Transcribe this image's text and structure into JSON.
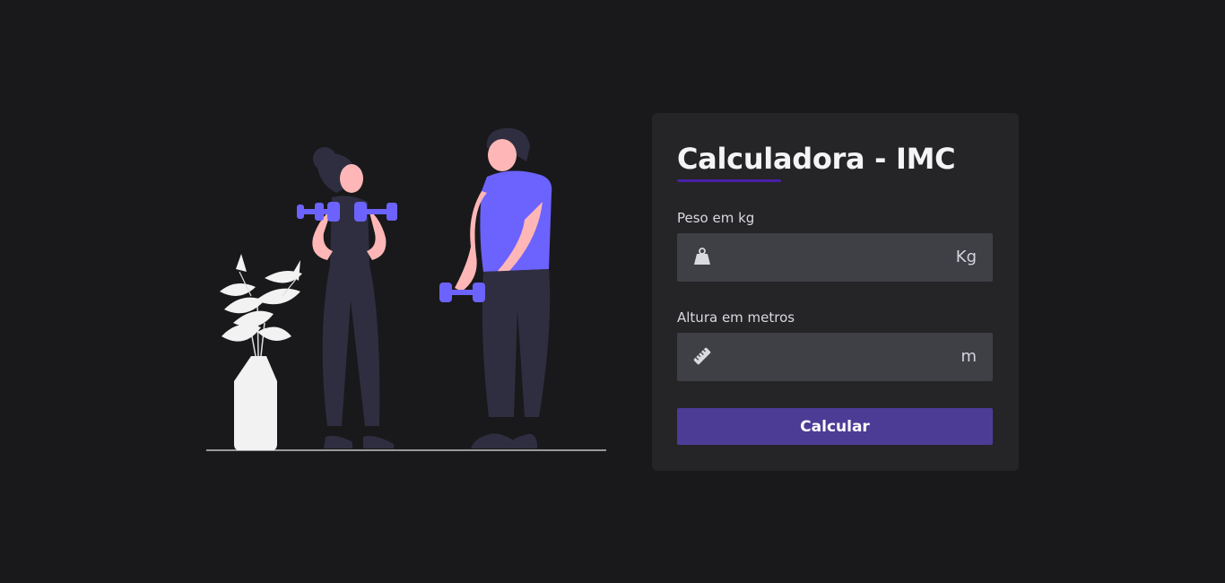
{
  "form": {
    "title": "Calculadora - IMC",
    "weight": {
      "label": "Peso em kg",
      "value": "",
      "placeholder": "",
      "unit": "Kg",
      "icon": "weight-icon"
    },
    "height": {
      "label": "Altura em metros",
      "value": "",
      "placeholder": "",
      "unit": "m",
      "icon": "ruler-icon"
    },
    "submit_label": "Calcular"
  },
  "colors": {
    "background": "#19191b",
    "card": "#252527",
    "input": "#3f3f46",
    "accent": "#4d3c96",
    "dumbbell": "#6c63ff",
    "skin": "#ffb6b6"
  }
}
